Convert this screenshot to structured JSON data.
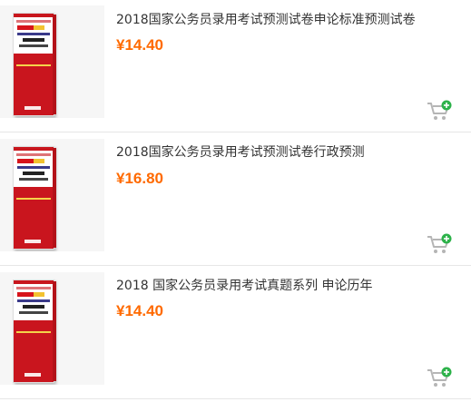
{
  "products": [
    {
      "title": "2018国家公务员录用考试预测试卷申论标准预测试卷",
      "price": "¥14.40",
      "cover_icon": "book-cover-image",
      "cart_icon": "add-to-cart-icon"
    },
    {
      "title": "2018国家公务员录用考试预测试卷行政预测",
      "price": "¥16.80",
      "cover_icon": "book-cover-image",
      "cart_icon": "add-to-cart-icon"
    },
    {
      "title": "2018 国家公务员录用考试真题系列 申论历年",
      "price": "¥14.40",
      "cover_icon": "book-cover-image",
      "cart_icon": "add-to-cart-icon"
    }
  ],
  "colors": {
    "price": "#ff6a00",
    "title": "#333333",
    "cart": "#aaaaaa",
    "cart_plus": "#2db24a",
    "cover_red": "#c9151e",
    "divider": "#e6e6e6"
  }
}
